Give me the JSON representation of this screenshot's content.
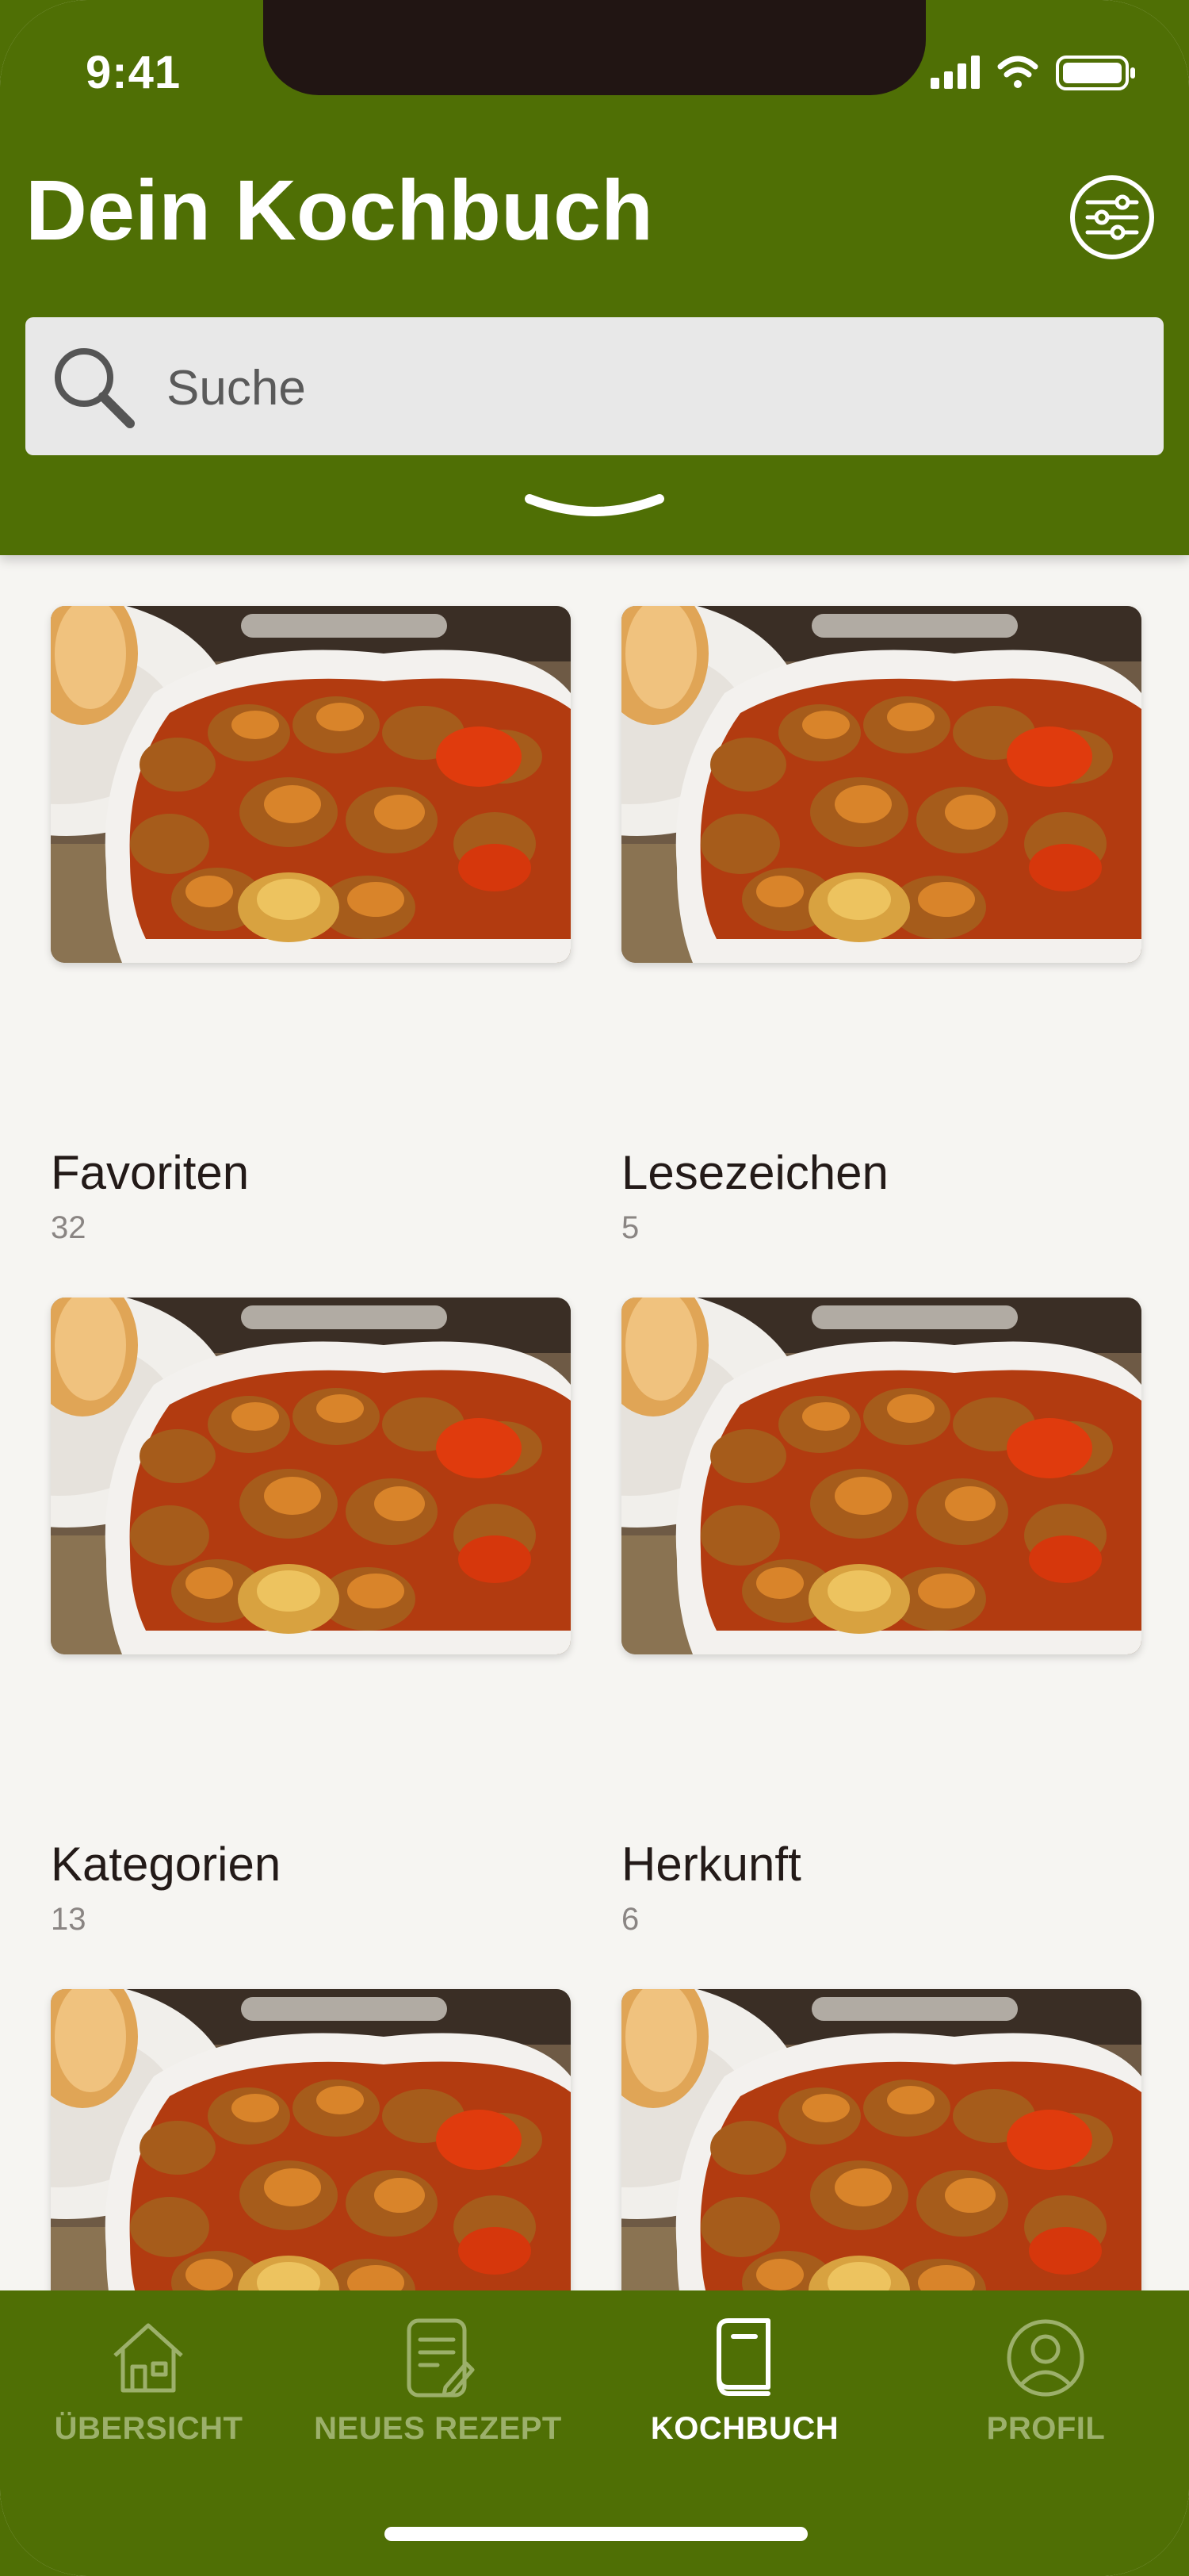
{
  "status": {
    "time": "9:41"
  },
  "header": {
    "title": "Dein Kochbuch"
  },
  "search": {
    "placeholder": "Suche"
  },
  "collections": [
    {
      "name": "Favoriten",
      "count": "32"
    },
    {
      "name": "Lesezeichen",
      "count": "5"
    },
    {
      "name": "Kategorien",
      "count": "13"
    },
    {
      "name": "Herkunft",
      "count": "6"
    },
    {
      "name": "",
      "count": ""
    },
    {
      "name": "",
      "count": ""
    }
  ],
  "tabs": [
    {
      "label": "ÜBERSICHT",
      "icon": "house-icon"
    },
    {
      "label": "NEUES REZEPT",
      "icon": "recipe-note-icon"
    },
    {
      "label": "KOCHBUCH",
      "icon": "cookbook-icon"
    },
    {
      "label": "PROFIL",
      "icon": "profile-icon"
    }
  ],
  "active_tab": "KOCHBUCH",
  "colors": {
    "brand_green": "#4f6f05",
    "background": "#f6f5f2",
    "inactive_tab": "#9cb06b",
    "active_tab": "#ffffff"
  }
}
